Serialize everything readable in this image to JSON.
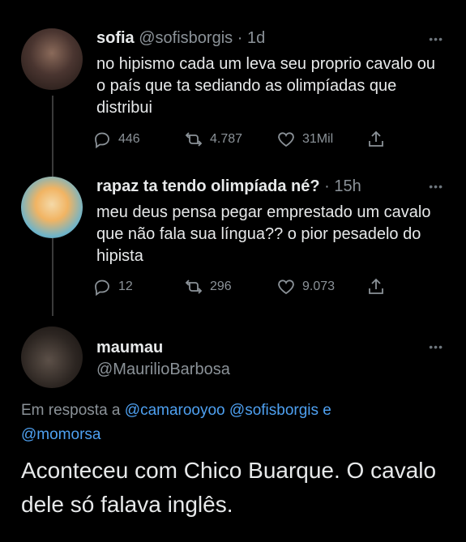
{
  "tweets": [
    {
      "name": "sofia",
      "handle": "@sofisborgis",
      "dot": "·",
      "time": "1d",
      "text": "no hipismo cada um leva seu proprio cavalo ou o país que ta sediando as olimpíadas que distribui",
      "replies": "446",
      "retweets": "4.787",
      "likes": "31Mil",
      "more": "•••"
    },
    {
      "name": "rapaz ta tendo olimpíada né?",
      "dot": "·",
      "time": "15h",
      "text": "meu deus pensa pegar emprestado um cavalo que não fala sua língua?? o pior pesadelo do hipista",
      "replies": "12",
      "retweets": "296",
      "likes": "9.073",
      "more": "•••"
    },
    {
      "name": "maumau",
      "handle": "@MaurilioBarbosa",
      "more": "•••",
      "reply_prefix": "Em resposta a",
      "mention1": "@camarooyoo",
      "mention2": "@sofisborgis",
      "conj": "e",
      "mention3": "@momorsa",
      "text": "Aconteceu com Chico Buarque. O cavalo dele só falava inglês."
    }
  ],
  "colors": {
    "background": "#000000",
    "text": "#e7e9ea",
    "secondary": "#8b9298",
    "link": "#4ea0f0"
  },
  "icons": [
    "reply-icon",
    "retweet-icon",
    "like-icon",
    "share-icon",
    "more-icon"
  ]
}
